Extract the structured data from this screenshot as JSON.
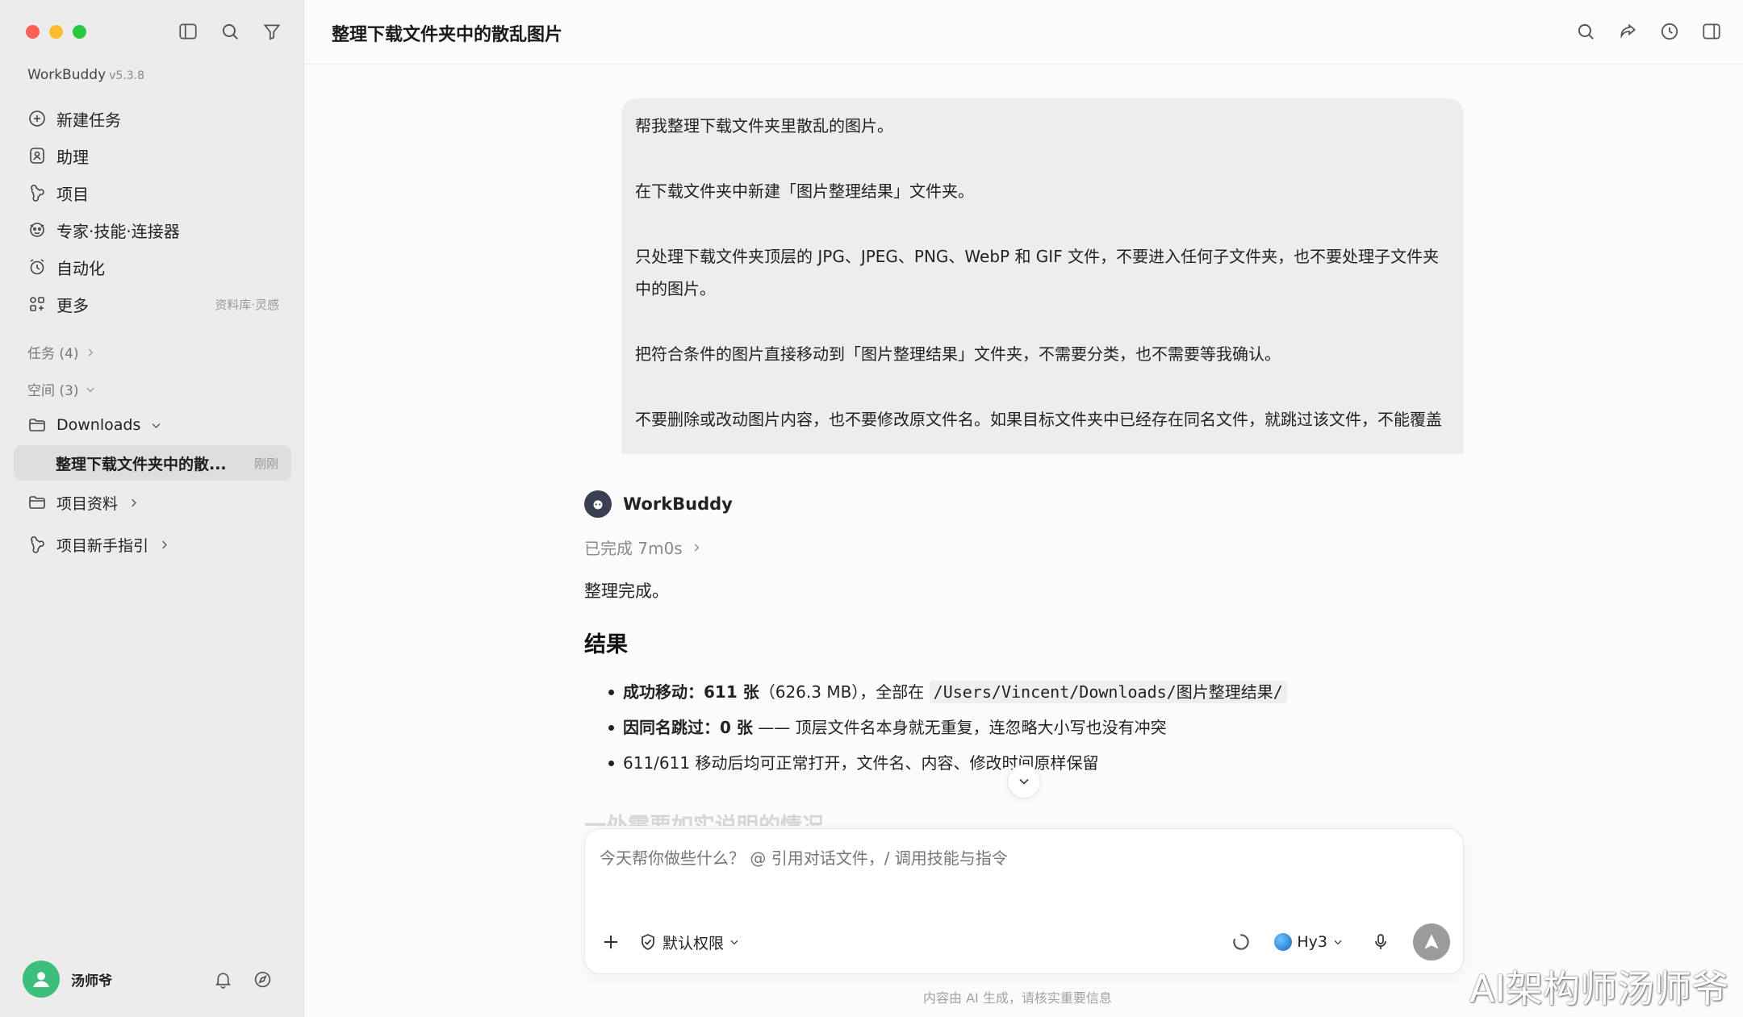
{
  "window": {
    "title": "整理下载文件夹中的散乱图片"
  },
  "sidebar": {
    "brand": "WorkBuddy",
    "version": "v5.3.8",
    "nav": [
      {
        "label": "新建任务",
        "icon": "plus-circle-icon"
      },
      {
        "label": "助理",
        "icon": "assistant-icon"
      },
      {
        "label": "项目",
        "icon": "project-icon"
      },
      {
        "label": "专家·技能·连接器",
        "icon": "expert-icon"
      },
      {
        "label": "自动化",
        "icon": "alarm-clock-icon"
      },
      {
        "label": "更多",
        "icon": "apps-icon",
        "extra": "资料库·灵感"
      }
    ],
    "tasks_header": "任务 (4)",
    "spaces_header": "空间 (3)",
    "folders": [
      {
        "label": "Downloads"
      },
      {
        "label": "项目资料"
      },
      {
        "label": "项目新手指引"
      }
    ],
    "active_task": {
      "label": "整理下载文件夹中的散...",
      "time": "刚刚"
    },
    "user": {
      "name": "汤师爷"
    }
  },
  "chat": {
    "user_message": [
      "帮我整理下载文件夹里散乱的图片。",
      "在下载文件夹中新建「图片整理结果」文件夹。",
      "只处理下载文件夹顶层的 JPG、JPEG、PNG、WebP 和 GIF 文件，不要进入任何子文件夹，也不要处理子文件夹中的图片。",
      "把符合条件的图片直接移动到「图片整理结果」文件夹，不需要分类，也不需要等我确认。",
      "不要删除或改动图片内容，也不要修改原文件名。如果目标文件夹中已经存在同名文件，就跳过该文件，不能覆盖"
    ],
    "agent_name": "WorkBuddy",
    "status": "已完成 7m0s",
    "summary": "整理完成。",
    "result_heading": "结果",
    "bullets": {
      "b1_label": "成功移动：611 张",
      "b1_text": "（626.3 MB），全部在 ",
      "b1_path": "/Users/Vincent/Downloads/图片整理结果/",
      "b2_label": "因同名跳过：0 张",
      "b2_text": " —— 顶层文件名本身就无重复，连忽略大小写也没有冲突",
      "b3_text": "611/611 移动后均可正常打开，文件名、内容、修改时间原样保留"
    },
    "faded_heading": "一处需要如实说明的情况"
  },
  "composer": {
    "placeholder": "今天帮你做些什么？ @ 引用对话文件，/ 调用技能与指令",
    "permission": "默认权限",
    "model": "Hy3"
  },
  "footer_note": "内容由 AI 生成，请核实重要信息",
  "watermark": "AI架构师汤师爷"
}
